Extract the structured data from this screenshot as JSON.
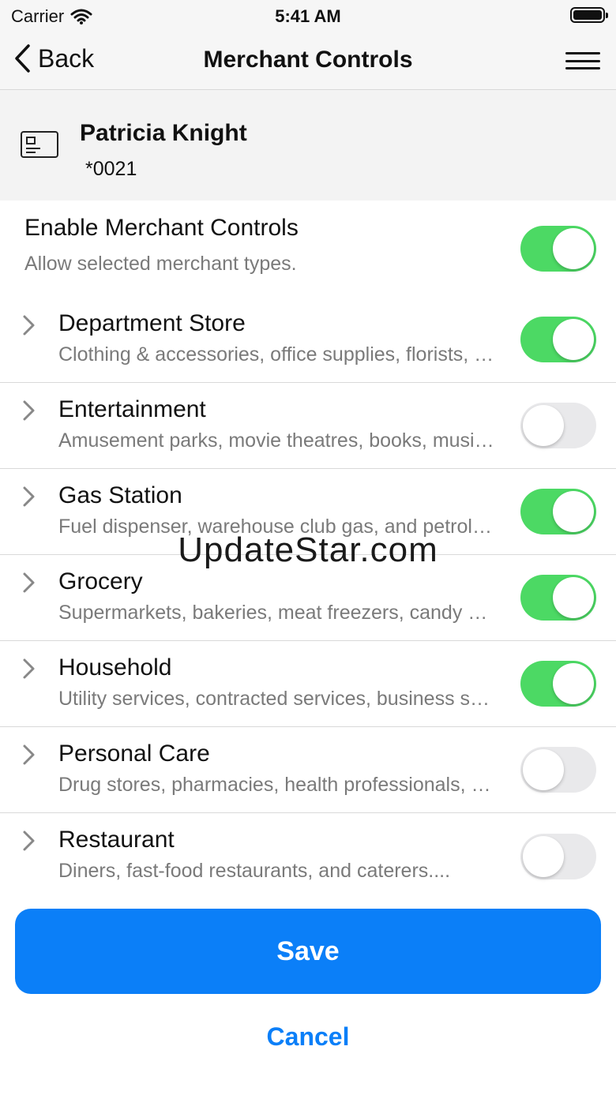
{
  "status_bar": {
    "carrier": "Carrier",
    "time": "5:41 AM"
  },
  "nav": {
    "back_label": "Back",
    "title": "Merchant Controls"
  },
  "card": {
    "name": "Patricia Knight",
    "number": "*0021"
  },
  "master": {
    "title": "Enable Merchant Controls",
    "subtitle": "Allow selected merchant types.",
    "enabled": true
  },
  "categories": [
    {
      "title": "Department Store",
      "subtitle": "Clothing & accessories, office supplies, florists, and more.",
      "enabled": true
    },
    {
      "title": "Entertainment",
      "subtitle": "Amusement parks, movie theatres, books, music, and more.",
      "enabled": false
    },
    {
      "title": "Gas Station",
      "subtitle": "Fuel dispenser, warehouse club gas, and petroleum products.",
      "enabled": true
    },
    {
      "title": "Grocery",
      "subtitle": "Supermarkets, bakeries, meat freezers, candy stores, and more.",
      "enabled": true
    },
    {
      "title": "Household",
      "subtitle": "Utility services, contracted services, business services, and more.",
      "enabled": true
    },
    {
      "title": "Personal Care",
      "subtitle": "Drug stores, pharmacies, health professionals, and more.",
      "enabled": false
    },
    {
      "title": "Restaurant",
      "subtitle": "Diners, fast-food restaurants, and caterers....",
      "enabled": false
    }
  ],
  "watermark": "UpdateStar.com",
  "actions": {
    "save_label": "Save",
    "cancel_label": "Cancel"
  },
  "colors": {
    "accent": "#0b7ff8",
    "toggle_on": "#4cd964",
    "toggle_off": "#e9e9eb"
  },
  "icons": {
    "back": "chevron-left-icon",
    "menu": "hamburger-menu-icon",
    "card": "credit-card-icon",
    "expand": "chevron-right-icon"
  }
}
